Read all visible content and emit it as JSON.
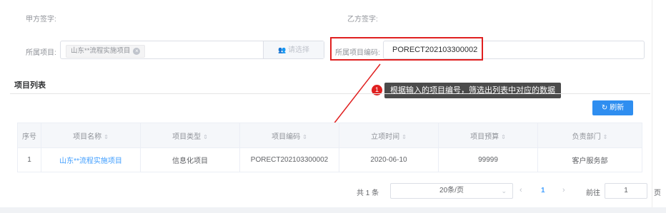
{
  "signature": {
    "party_a": "甲方签字:",
    "party_b": "乙方签字:"
  },
  "filters": {
    "project_label": "所属项目:",
    "project_tag": "山东**流程实施项目",
    "pick_button": "请选择",
    "code_label": "所属项目编码:",
    "code_value": "PORECT202103300002"
  },
  "section": {
    "title": "项目列表"
  },
  "annotation": {
    "badge": "1",
    "text": "根据输入的项目编号，筛选出列表中对应的数据",
    "color": "#e02020"
  },
  "toolbar": {
    "refresh_label": "刷新"
  },
  "table": {
    "columns": [
      "序号",
      "项目名称",
      "项目类型",
      "项目编码",
      "立项时间",
      "项目预算",
      "负责部门"
    ],
    "rows": [
      [
        "1",
        "山东**流程实施项目",
        "信息化项目",
        "PORECT202103300002",
        "2020-06-10",
        "99999",
        "客户服务部"
      ]
    ]
  },
  "pager": {
    "total": "共 1 条",
    "page_size": "20条/页",
    "current_page": "1",
    "goto_label": "前往",
    "goto_value": "1",
    "page_suffix": "页"
  },
  "colors": {
    "primary": "#2f8ef0",
    "link": "#409eff",
    "highlight": "#e02020"
  }
}
